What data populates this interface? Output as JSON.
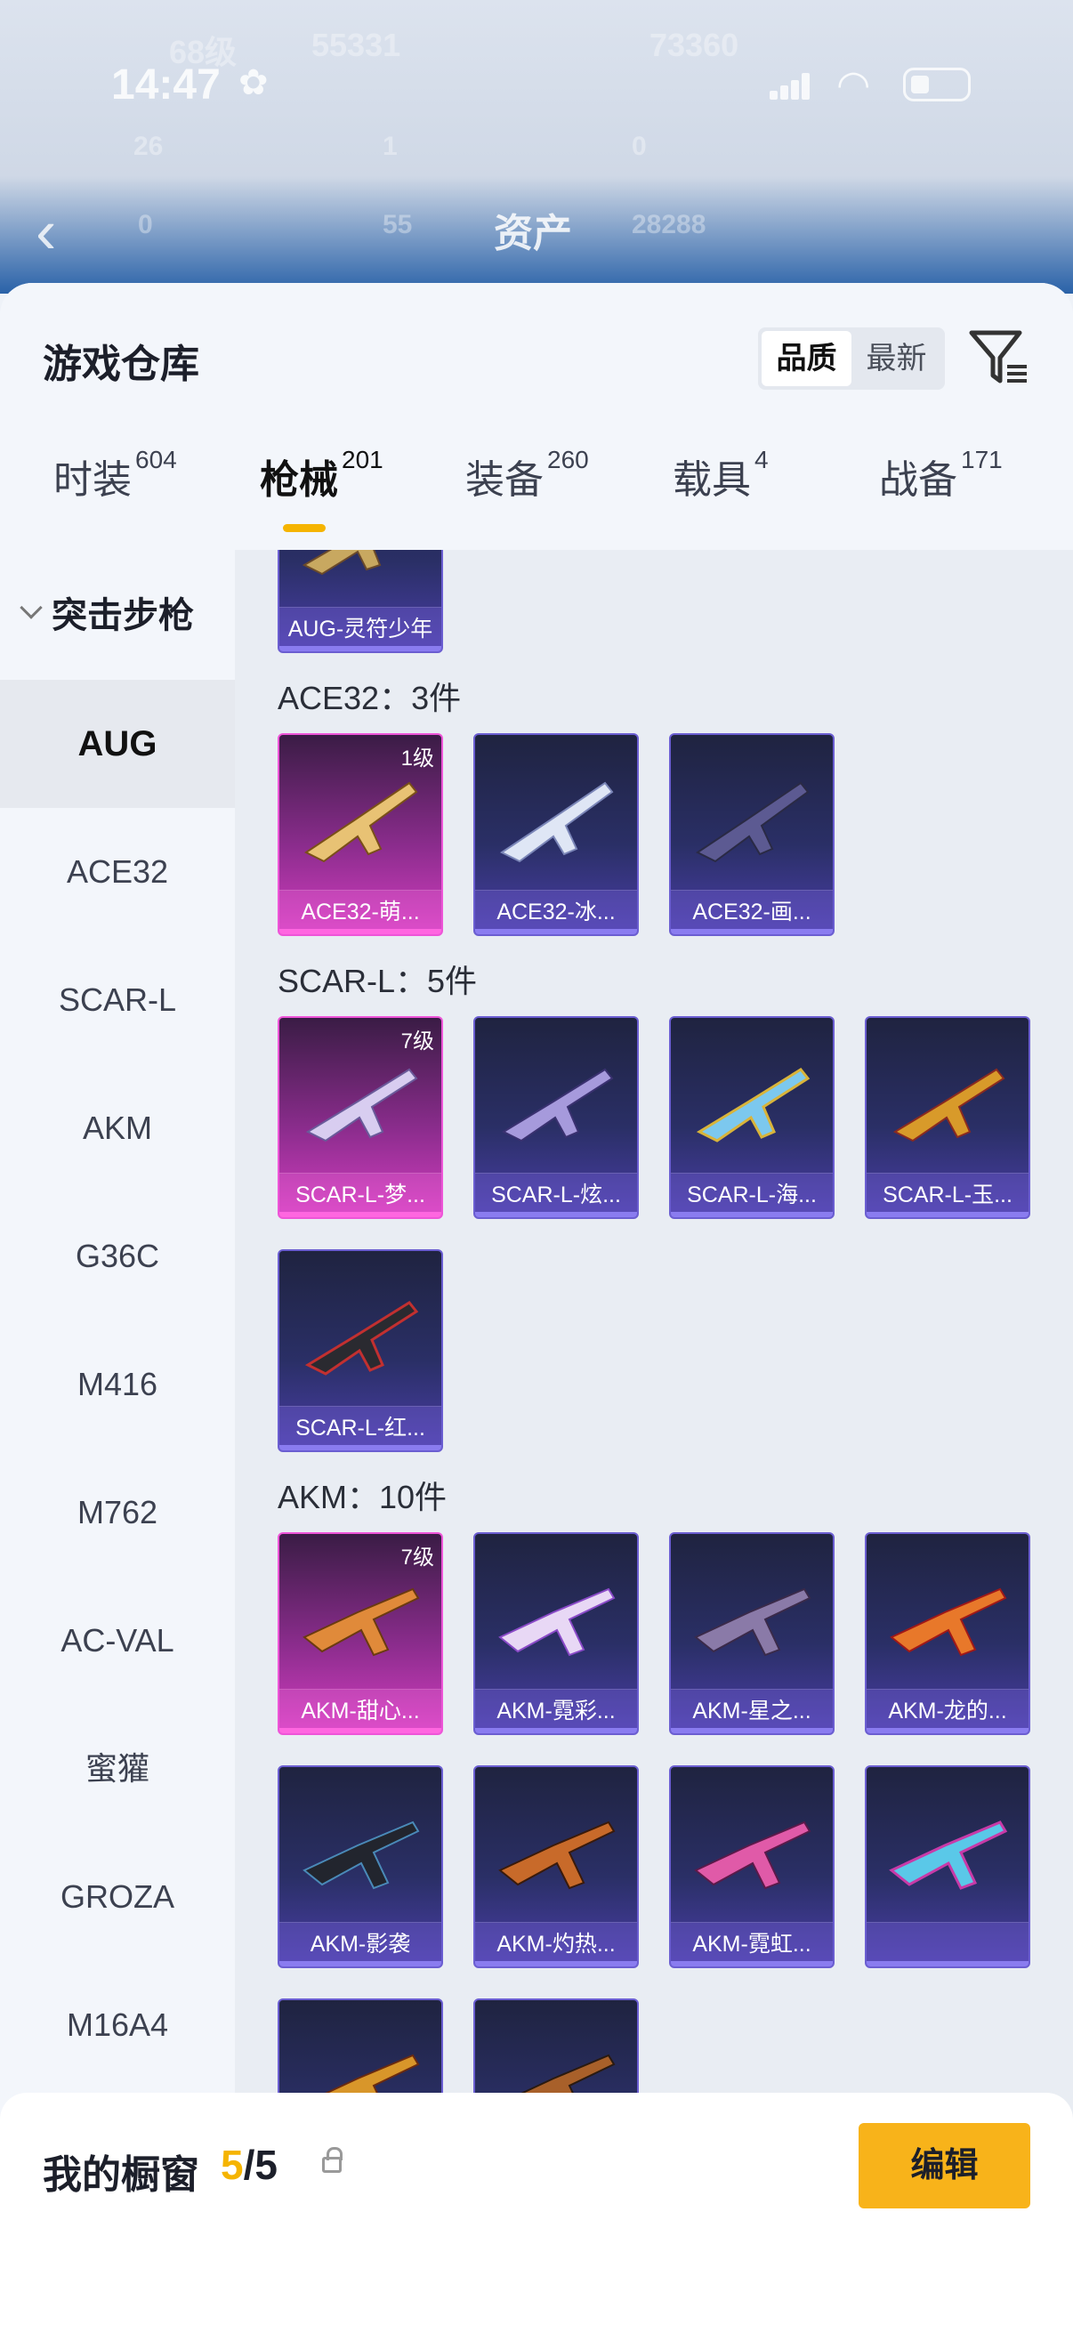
{
  "status_bar": {
    "time": "14:47"
  },
  "background_header": {
    "level": "68级",
    "coins1": "55331",
    "coins2": "73360",
    "stat1": "26",
    "stat2": "1",
    "stat3": "0",
    "stat4": "0",
    "stat5": "55",
    "stat6": "28288",
    "title": "资产"
  },
  "sheet": {
    "title": "游戏仓库",
    "sort": {
      "quality": "品质",
      "newest": "最新"
    }
  },
  "tabs": [
    {
      "label": "时装",
      "count": "604"
    },
    {
      "label": "枪械",
      "count": "201"
    },
    {
      "label": "装备",
      "count": "260"
    },
    {
      "label": "载具",
      "count": "4"
    },
    {
      "label": "战备",
      "count": "171"
    }
  ],
  "sidebar": {
    "category": "突击步枪",
    "items": [
      "AUG",
      "ACE32",
      "SCAR-L",
      "AKM",
      "G36C",
      "M416",
      "M762",
      "AC-VAL",
      "蜜獾",
      "GROZA",
      "M16A4"
    ]
  },
  "groups": {
    "aug_card": "AUG-灵符少年",
    "ace32": {
      "title": "ACE32：3件",
      "cards": [
        {
          "name": "ACE32-萌...",
          "level": "1级"
        },
        {
          "name": "ACE32-冰...",
          "level": ""
        },
        {
          "name": "ACE32-画...",
          "level": ""
        }
      ]
    },
    "scarl": {
      "title": "SCAR-L：5件",
      "cards": [
        {
          "name": "SCAR-L-梦...",
          "level": "7级"
        },
        {
          "name": "SCAR-L-炫...",
          "level": ""
        },
        {
          "name": "SCAR-L-海...",
          "level": ""
        },
        {
          "name": "SCAR-L-玉...",
          "level": ""
        },
        {
          "name": "SCAR-L-红...",
          "level": ""
        }
      ]
    },
    "akm": {
      "title": "AKM：10件",
      "cards": [
        {
          "name": "AKM-甜心...",
          "level": "7级"
        },
        {
          "name": "AKM-霓彩...",
          "level": ""
        },
        {
          "name": "AKM-星之...",
          "level": ""
        },
        {
          "name": "AKM-龙的...",
          "level": ""
        },
        {
          "name": "AKM-影袭",
          "level": ""
        },
        {
          "name": "AKM-灼热...",
          "level": ""
        },
        {
          "name": "AKM-霓虹...",
          "level": ""
        },
        {
          "name": "",
          "level": ""
        },
        {
          "name": "",
          "level": ""
        },
        {
          "name": "",
          "level": ""
        }
      ]
    }
  },
  "footer": {
    "label": "我的橱窗",
    "current": "5",
    "total": "/5",
    "edit": "编辑"
  },
  "colors": {
    "accent": "#f5b400",
    "pink_card": "#d33ec0",
    "purple_card": "#4a3ea8"
  }
}
